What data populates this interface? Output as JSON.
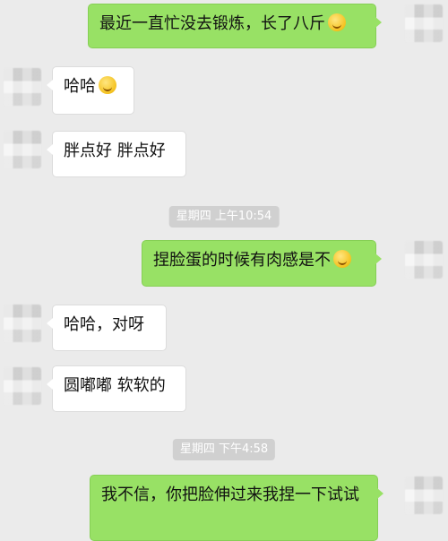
{
  "messages": [
    {
      "text": "最近一直忙没去锻炼，长了八斤",
      "emoji": "sweat-laugh-emoji"
    },
    {
      "text": "哈哈",
      "emoji": "grin-emoji"
    },
    {
      "text": "胖点好 胖点好"
    },
    {
      "text": "捏脸蛋的时候有肉感是不",
      "emoji": "smile-emoji"
    },
    {
      "text": "哈哈，对呀"
    },
    {
      "text": "圆嘟嘟 软软的"
    },
    {
      "text": "我不信，你把脸伸过来我捏一下试试"
    }
  ],
  "timestamps": [
    "星期四 上午10:54",
    "星期四 下午4:58"
  ],
  "colors": {
    "background": "#ebebeb",
    "outgoing_bubble": "#98e165",
    "incoming_bubble": "#ffffff",
    "timestamp_pill": "#d0d0d0"
  }
}
